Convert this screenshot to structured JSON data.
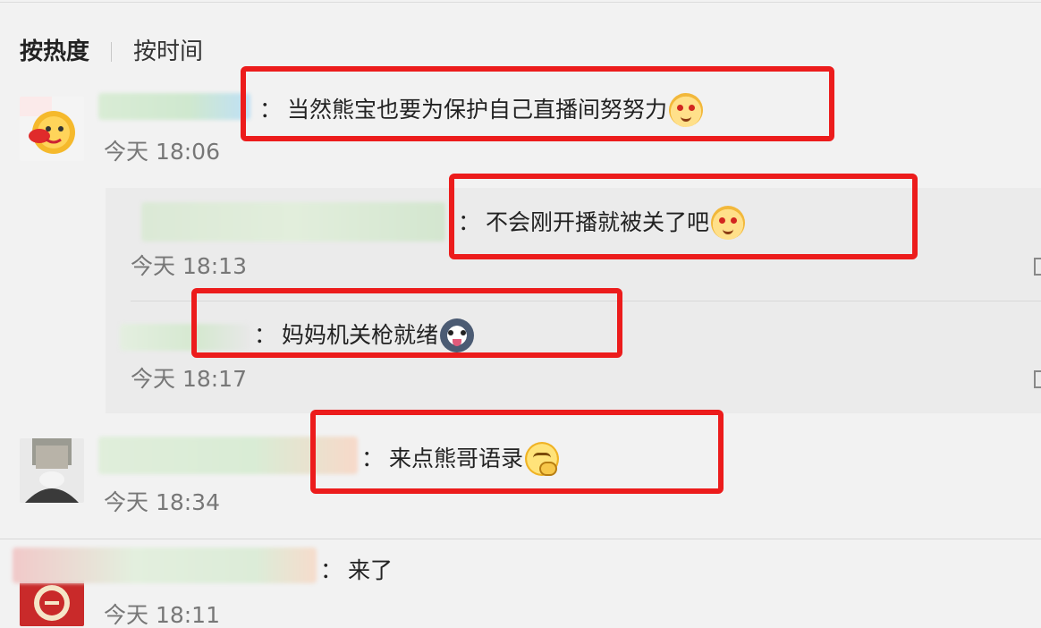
{
  "sort": {
    "hot_label": "按热度",
    "time_label": "按时间"
  },
  "comments": [
    {
      "text": "当然熊宝也要为保护自己直播间努努力",
      "time": "今天 18:06",
      "emoji": "cat-face-icon"
    },
    {
      "text": "来点熊哥语录",
      "time": "今天 18:34",
      "emoji": "thinking-face-icon"
    },
    {
      "text": "来了",
      "time": "今天 18:11"
    }
  ],
  "replies": [
    {
      "text": "不会刚开播就被关了吧",
      "time": "今天 18:13",
      "emoji": "cat-face-icon"
    },
    {
      "text": "妈妈机关枪就绪",
      "time": "今天 18:17",
      "emoji": "husky-icon"
    }
  ],
  "colon": "：",
  "colors": {
    "highlight_border": "#ec1c1c",
    "background": "#f2f2f2",
    "reply_background": "#ebebeb"
  }
}
